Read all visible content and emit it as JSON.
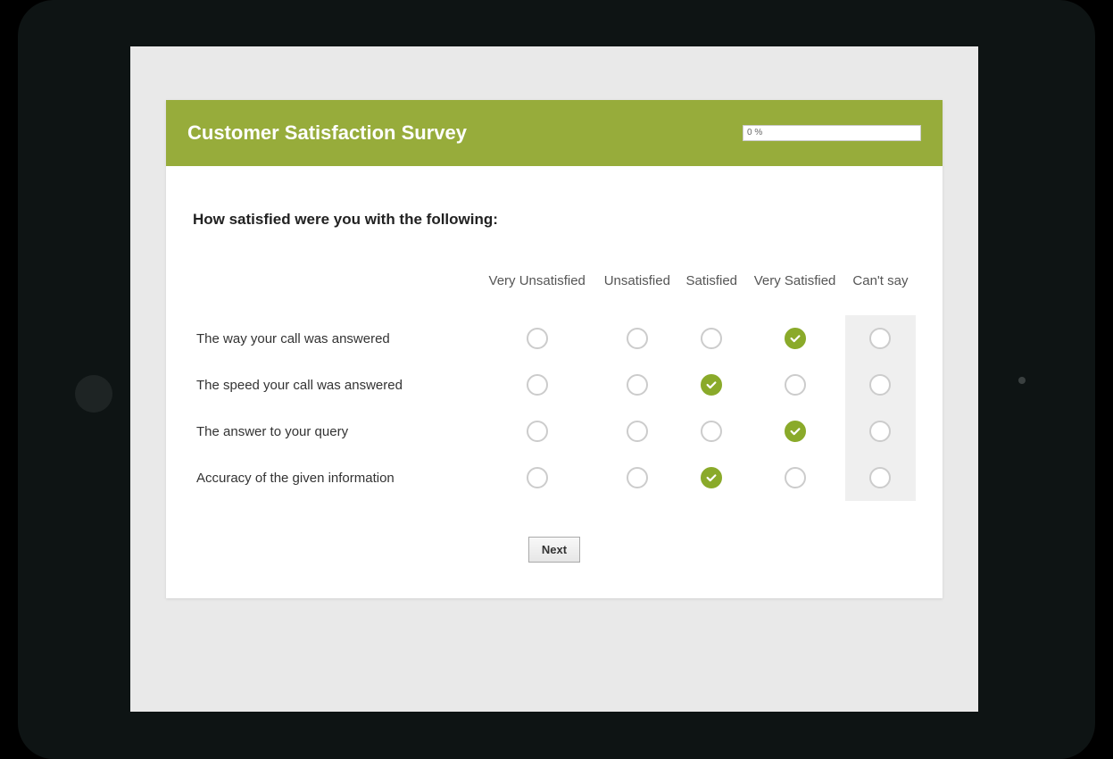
{
  "survey": {
    "title": "Customer Satisfaction Survey",
    "progress": "0 %",
    "question": "How satisfied were you with the following:",
    "columns": [
      "Very Unsatisfied",
      "Unsatisfied",
      "Satisfied",
      "Very Satisfied",
      "Can't say"
    ],
    "rows": [
      {
        "label": "The way your call was answered",
        "selected": 3
      },
      {
        "label": "The speed your call was answered",
        "selected": 2
      },
      {
        "label": "The answer to your query",
        "selected": 3
      },
      {
        "label": "Accuracy of the given information",
        "selected": 2
      }
    ],
    "shaded_column": 4,
    "next_label": "Next"
  },
  "colors": {
    "accent": "#97ac3b",
    "radio_selected": "#8aaa2a"
  }
}
